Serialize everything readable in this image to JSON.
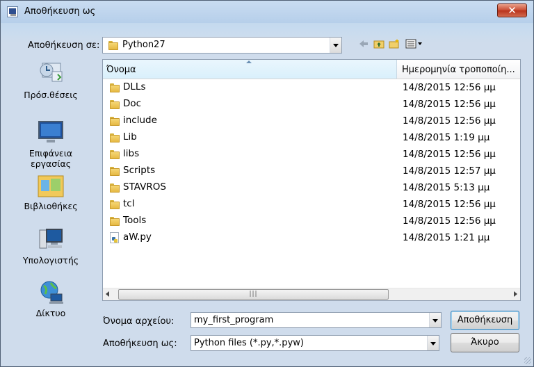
{
  "window": {
    "title": "Αποθήκευση ως",
    "close_label": "✕"
  },
  "location": {
    "label": "Αποθήκευση σε:",
    "value": "Python27"
  },
  "places": [
    {
      "label": "Πρόσ.θέσεις",
      "icon": "recent-places-icon"
    },
    {
      "label": "Επιφάνεια εργασίας",
      "icon": "desktop-icon"
    },
    {
      "label": "Βιβλιοθήκες",
      "icon": "libraries-icon"
    },
    {
      "label": "Υπολογιστής",
      "icon": "computer-icon"
    },
    {
      "label": "Δίκτυο",
      "icon": "network-icon"
    }
  ],
  "columns": {
    "name": "Όνομα",
    "date": "Ημερομηνία τροποποίη..."
  },
  "files": [
    {
      "name": "DLLs",
      "date": "14/8/2015 12:56 μμ",
      "type": "folder"
    },
    {
      "name": "Doc",
      "date": "14/8/2015 12:56 μμ",
      "type": "folder"
    },
    {
      "name": "include",
      "date": "14/8/2015 12:56 μμ",
      "type": "folder"
    },
    {
      "name": "Lib",
      "date": "14/8/2015 1:19 μμ",
      "type": "folder"
    },
    {
      "name": "libs",
      "date": "14/8/2015 12:56 μμ",
      "type": "folder"
    },
    {
      "name": "Scripts",
      "date": "14/8/2015 12:57 μμ",
      "type": "folder"
    },
    {
      "name": "STAVROS",
      "date": "14/8/2015 5:13 μμ",
      "type": "folder"
    },
    {
      "name": "tcl",
      "date": "14/8/2015 12:56 μμ",
      "type": "folder"
    },
    {
      "name": "Tools",
      "date": "14/8/2015 12:56 μμ",
      "type": "folder"
    },
    {
      "name": "aW.py",
      "date": "14/8/2015 1:21 μμ",
      "type": "python-file"
    }
  ],
  "filename": {
    "label": "Όνομα αρχείου:",
    "value": "my_first_program"
  },
  "filetype": {
    "label": "Αποθήκευση ως:",
    "value": "Python files (*.py,*.pyw)"
  },
  "buttons": {
    "save": "Αποθήκευση",
    "cancel": "Άκυρο"
  },
  "colors": {
    "accent": "#3c7fb1",
    "folder": "#e4b53e"
  }
}
